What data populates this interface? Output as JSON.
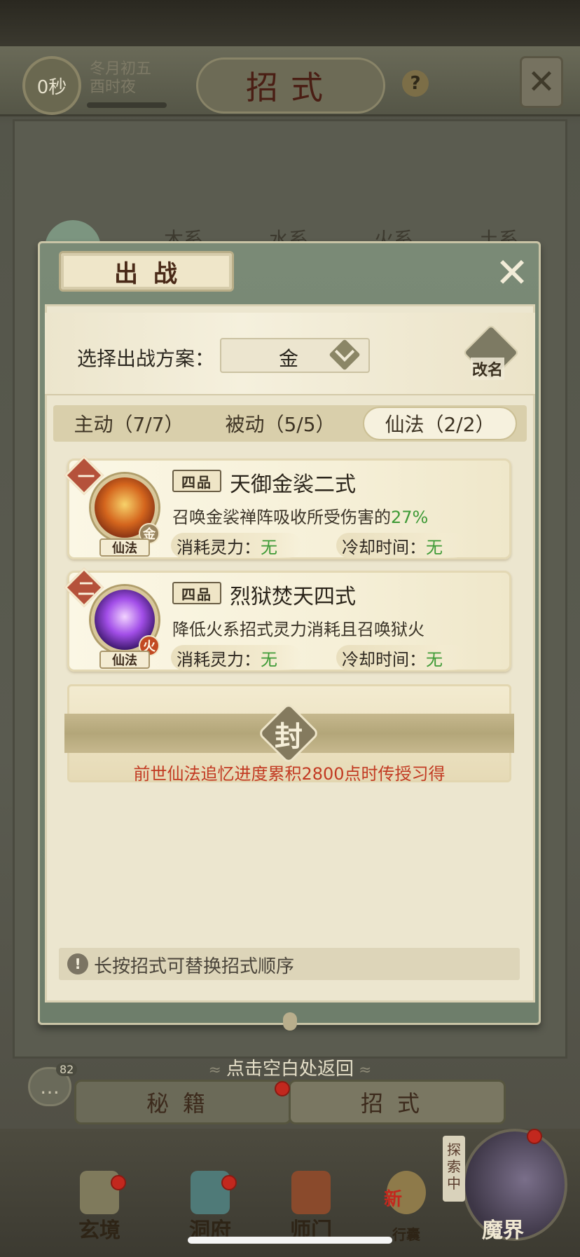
{
  "hud": {
    "timer": "0秒",
    "date_line1": "冬月初五",
    "date_line2": "酉时夜",
    "page_title": "招式",
    "help": "?",
    "close": "✕"
  },
  "background_tabs": [
    "木系",
    "水系",
    "火系",
    "土系"
  ],
  "modal": {
    "title": "出战",
    "close": "✕",
    "plan_label": "选择出战方案：",
    "plan_value": "金",
    "rename_label": "改名",
    "tabs": [
      {
        "label": "主动（7/7）",
        "active": false
      },
      {
        "label": "被动（5/5）",
        "active": false
      },
      {
        "label": "仙法（2/2）",
        "active": true
      }
    ],
    "skills": [
      {
        "index": "一",
        "type": "仙法",
        "element": "金",
        "grade": "四品",
        "name": "天御金裟二式",
        "desc": "召唤金裟禅阵吸收所受伤害的",
        "desc_highlight": "27%",
        "cost_label": "消耗灵力：",
        "cost_value": "无",
        "cooldown_label": "冷却时间：",
        "cooldown_value": "无",
        "orb_icon": "golden-robe-skill-icon"
      },
      {
        "index": "二",
        "type": "仙法",
        "element": "火",
        "grade": "四品",
        "name": "烈狱焚天四式",
        "desc": "降低火系招式灵力消耗且召唤狱火",
        "desc_highlight": "",
        "cost_label": "消耗灵力：",
        "cost_value": "无",
        "cooldown_label": "冷却时间：",
        "cooldown_value": "无",
        "orb_icon": "purple-flame-skill-icon"
      }
    ],
    "sealed_char": "封",
    "sealed_hint": "前世仙法追忆进度累积2800点时传授习得",
    "tip": "长按招式可替换招式顺序",
    "tip_icon": "!"
  },
  "back_hint": "点击空白处返回",
  "chat": {
    "count": "82"
  },
  "subtabs": {
    "left": "秘籍",
    "right": "招式"
  },
  "bottom_nav": [
    {
      "label": "玄境",
      "icon": "scroll-icon"
    },
    {
      "label": "洞府",
      "icon": "pavilion-icon"
    },
    {
      "label": "师门",
      "icon": "banner-icon"
    },
    {
      "label": "行囊",
      "icon": "bag-icon"
    },
    {
      "label": "魔界",
      "icon": "demon-realm-icon"
    }
  ],
  "bag_new": "新",
  "explore_tag": "探索中",
  "colors": {
    "accent_red": "#c23a22",
    "value_green": "#3e9a36",
    "panel_cream": "#ece6cf",
    "modal_green": "#7a8a76"
  }
}
